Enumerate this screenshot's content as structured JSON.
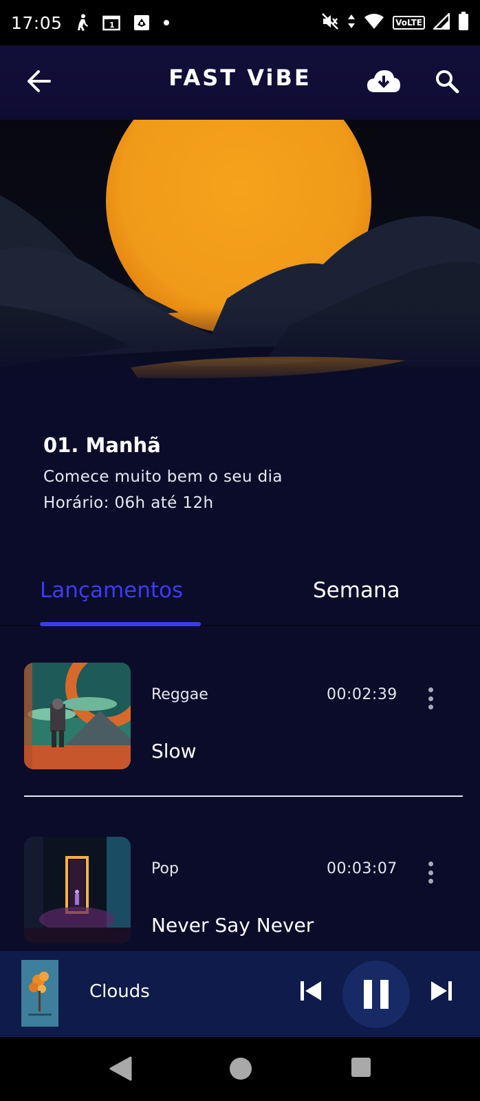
{
  "status_bar": {
    "time": "17:05",
    "icons": [
      "walk-icon",
      "calendar-icon",
      "nfc-icon",
      "dot-icon"
    ],
    "right_icons": [
      "mute-icon",
      "data-arrows-icon",
      "wifi-icon",
      "volte-icon",
      "signal-icon",
      "battery-icon"
    ],
    "volte_label": "VoLTE"
  },
  "app_bar": {
    "logo": "FAST ViBE",
    "back_icon": "arrow-left-icon",
    "download_icon": "cloud-download-icon",
    "search_icon": "search-icon"
  },
  "hero": {
    "image": "sunset-over-mountains",
    "colors": {
      "sun": "#f2a11e",
      "sky": "#06070f",
      "hills": "#1b2233"
    }
  },
  "playlist": {
    "title": "01. Manhã",
    "subtitle": "Comece muito bem o seu dia",
    "schedule": "Horário: 06h até 12h"
  },
  "tabs": {
    "items": [
      {
        "label": "Lançamentos",
        "active": true
      },
      {
        "label": "Semana",
        "active": false
      }
    ],
    "accent": "#3b3cf0"
  },
  "tracks": [
    {
      "genre": "Reggae",
      "duration": "00:02:39",
      "title": "Slow",
      "art": "astronaut-portal-art"
    },
    {
      "genre": "Pop",
      "duration": "00:03:07",
      "title": "Never Say Never",
      "art": "neon-door-forest-art"
    }
  ],
  "mini_player": {
    "title": "Clouds",
    "art": "orange-tree-art",
    "state": "playing"
  },
  "colors": {
    "background": "#0b0c2a",
    "app_bar": "#120e3a",
    "player_bg": "#0f1b4a",
    "pause_circle": "#172a66"
  }
}
